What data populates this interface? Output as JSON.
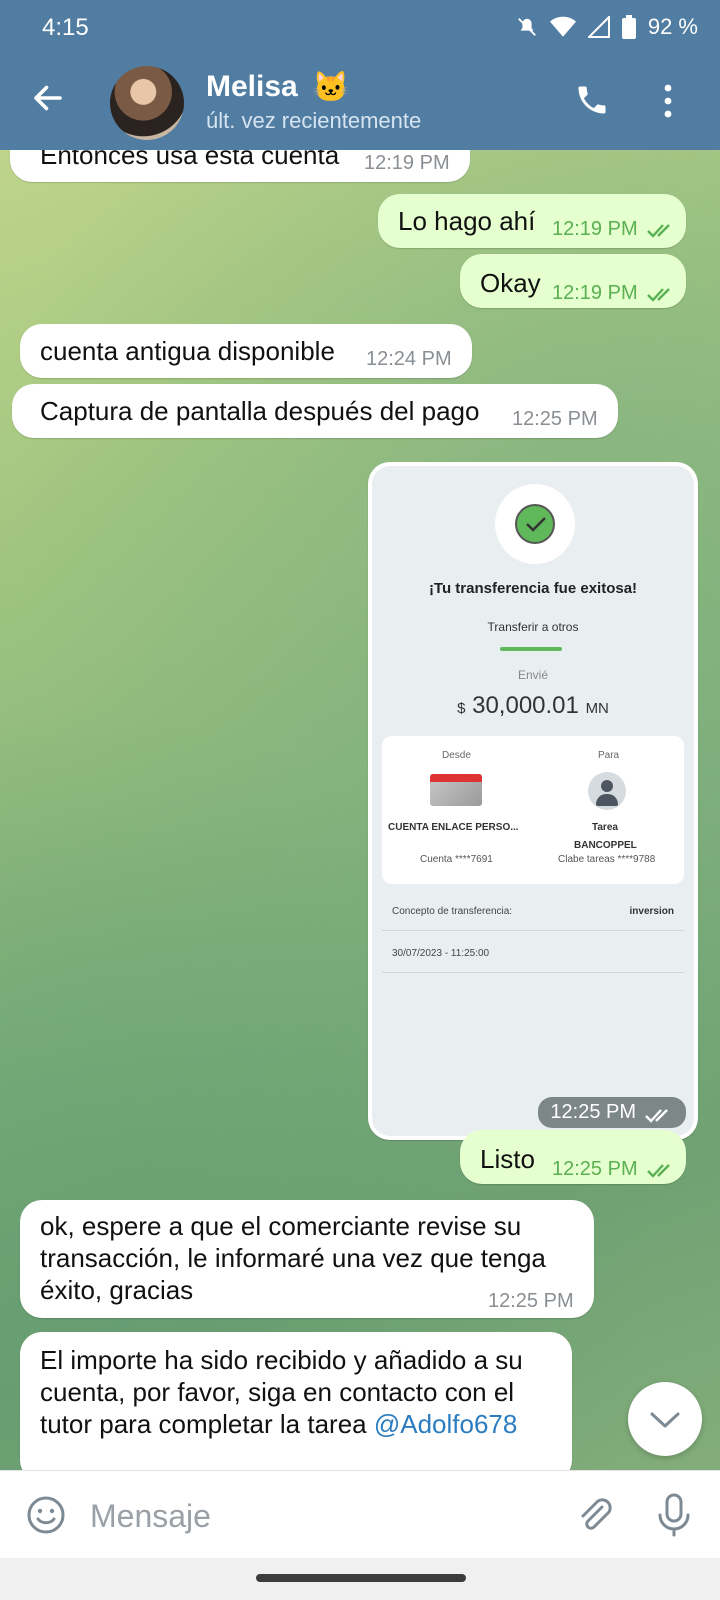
{
  "status_bar": {
    "time": "4:15",
    "battery": "92 %"
  },
  "header": {
    "contact_name": "Melisa",
    "contact_emoji": "🐱",
    "contact_status": "últ. vez recientemente"
  },
  "messages": [
    {
      "dir": "in",
      "text": "Entonces usa esta cuenta",
      "time": "12:19 PM"
    },
    {
      "dir": "out",
      "text": "Lo hago ahí",
      "time": "12:19 PM"
    },
    {
      "dir": "out",
      "text": "Okay",
      "time": "12:19 PM"
    },
    {
      "dir": "in",
      "text": "cuenta antigua disponible",
      "time": "12:24 PM"
    },
    {
      "dir": "in",
      "text": "Captura de pantalla después del pago",
      "time": "12:25 PM"
    },
    {
      "dir": "out",
      "text": "Listo",
      "time": "12:25 PM"
    },
    {
      "dir": "in",
      "text_lines": [
        "ok, espere a que el comerciante revise su",
        "transacción, le informaré una vez que tenga",
        "éxito, gracias"
      ],
      "time": "12:25 PM"
    },
    {
      "dir": "in",
      "text_lines": [
        "El importe ha sido recibido y añadido a su",
        "cuenta, por favor, siga en contacto con el",
        "tutor para completar la tarea"
      ],
      "mention": "@Adolfo678"
    }
  ],
  "transfer_screenshot": {
    "time": "12:25 PM",
    "title": "¡Tu transferencia fue exitosa!",
    "subtitle": "Transferir a otros",
    "sent_label": "Envié",
    "currency_symbol": "$",
    "amount": "30,000.01",
    "currency_code": "MN",
    "from_header": "Desde",
    "from_name": "CUENTA ENLACE PERSO...",
    "from_account": "Cuenta ****7691",
    "to_header": "Para",
    "to_name": "Tarea",
    "to_bank": "BANCOPPEL",
    "to_account": "Clabe tareas ****9788",
    "concept_label": "Concepto de transferencia:",
    "concept_value": "inversion",
    "datetime": "30/07/2023 - 11:25:00"
  },
  "composer": {
    "placeholder": "Mensaje"
  }
}
